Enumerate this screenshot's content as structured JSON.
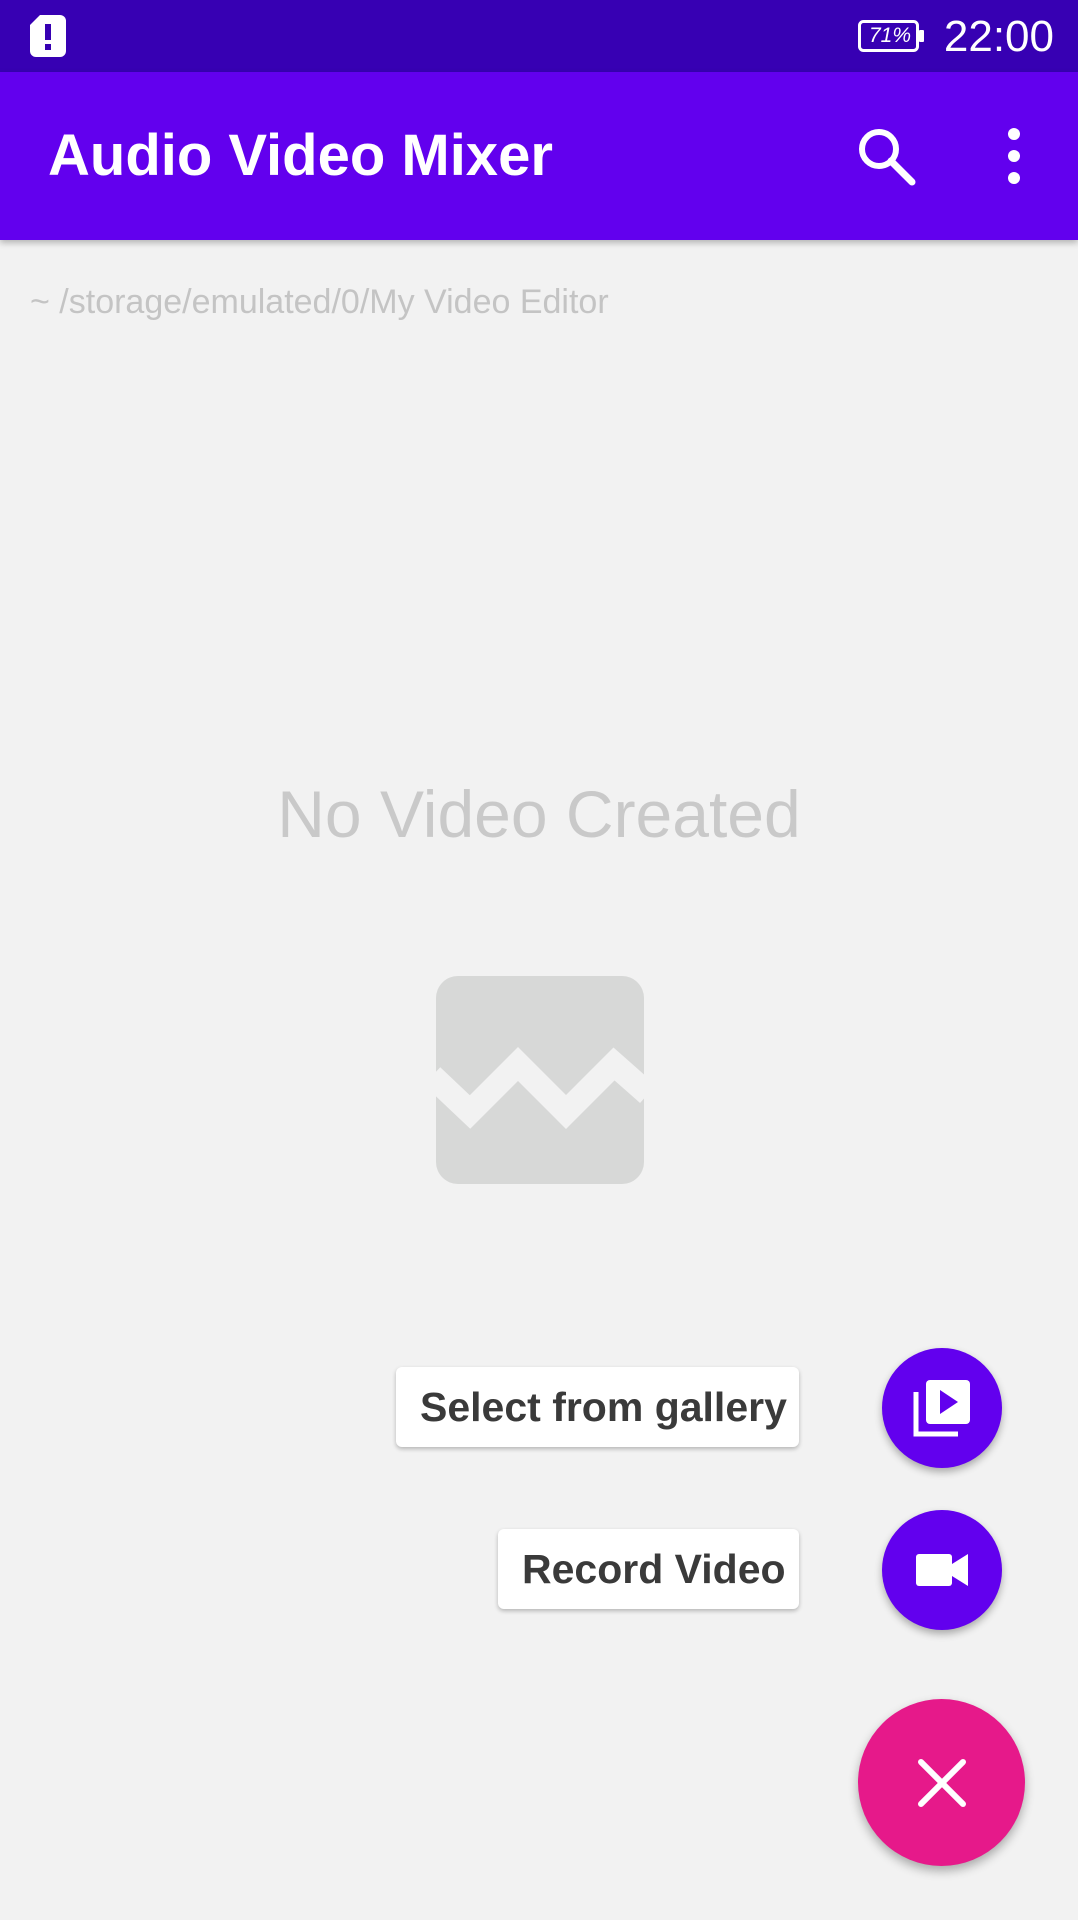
{
  "status_bar": {
    "battery": "71%",
    "time": "22:00",
    "icons": [
      "sim-alert-icon",
      "battery-icon"
    ]
  },
  "app_bar": {
    "title": "Audio Video Mixer",
    "icons": [
      "search-icon",
      "more-vert-icon"
    ]
  },
  "content": {
    "path": "~ /storage/emulated/0/My Video Editor",
    "empty_message": "No Video Created",
    "empty_icon": "broken-image-icon"
  },
  "fab_menu": {
    "items": [
      {
        "label": "Select from gallery",
        "icon": "video-library-icon"
      },
      {
        "label": "Record Video",
        "icon": "videocam-icon"
      }
    ],
    "main_icon": "close-icon"
  },
  "colors": {
    "status_bar": "#3700b3",
    "app_bar": "#6200ee",
    "background": "#f2f2f2",
    "mini_fab": "#6200ee",
    "main_fab": "#e6198a"
  }
}
